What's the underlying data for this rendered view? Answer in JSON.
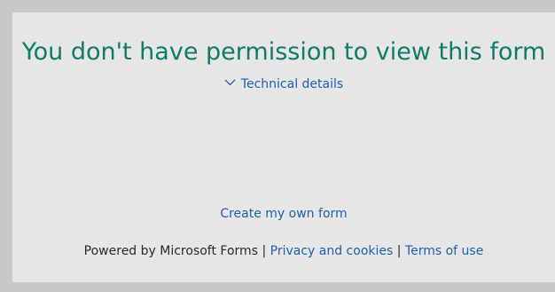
{
  "message": {
    "title": "You don't have permission to view this form"
  },
  "details": {
    "icon": "chevron-down-icon",
    "label": "Technical details"
  },
  "actions": {
    "create_form": "Create my own form"
  },
  "footer": {
    "powered_by": "Powered by Microsoft Forms",
    "separator": "|",
    "privacy": "Privacy and cookies",
    "terms": "Terms of use"
  },
  "colors": {
    "title": "#107c64",
    "link": "#1f5fb0",
    "panel": "#e6e6e6",
    "frame": "#c8c8c8"
  }
}
